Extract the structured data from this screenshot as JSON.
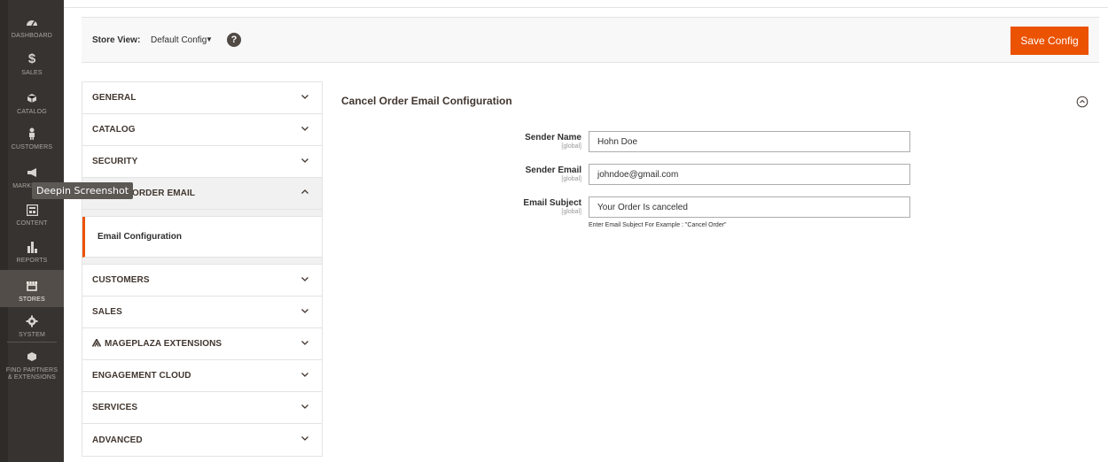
{
  "nav": {
    "items": [
      {
        "label": "DASHBOARD",
        "icon": "dashboard-icon"
      },
      {
        "label": "SALES",
        "icon": "dollar-icon"
      },
      {
        "label": "CATALOG",
        "icon": "cube-icon"
      },
      {
        "label": "CUSTOMERS",
        "icon": "person-icon"
      },
      {
        "label": "MARKETING",
        "icon": "megaphone-icon"
      },
      {
        "label": "CONTENT",
        "icon": "layout-icon"
      },
      {
        "label": "REPORTS",
        "icon": "bar-chart-icon"
      },
      {
        "label": "STORES",
        "icon": "store-icon"
      },
      {
        "label": "SYSTEM",
        "icon": "gear-icon"
      },
      {
        "label": "FIND PARTNERS & EXTENSIONS",
        "icon": "partners-icon"
      }
    ],
    "active": "STORES"
  },
  "tooltip": "Deepin Screenshot",
  "store_view": {
    "label": "Store View:",
    "value": "Default Config",
    "help": "?"
  },
  "save_button": "Save Config",
  "tabs": [
    {
      "label": "GENERAL"
    },
    {
      "label": "CATALOG"
    },
    {
      "label": "SECURITY"
    },
    {
      "label": "CANCEL ORDER EMAIL",
      "open": true
    },
    {
      "label": "CUSTOMERS"
    },
    {
      "label": "SALES"
    },
    {
      "label": "MAGEPLAZA EXTENSIONS"
    },
    {
      "label": "ENGAGEMENT CLOUD"
    },
    {
      "label": "SERVICES"
    },
    {
      "label": "ADVANCED"
    }
  ],
  "subtab": "Email Configuration",
  "section": {
    "title": "Cancel Order Email Configuration",
    "fields": [
      {
        "label": "Sender Name",
        "scope": "[global]",
        "value": "Hohn Doe"
      },
      {
        "label": "Sender Email",
        "scope": "[global]",
        "value": "johndoe@gmail.com"
      },
      {
        "label": "Email Subject",
        "scope": "[global]",
        "value": "Your Order Is canceled"
      }
    ],
    "subject_note": "Enter Email Subject For Example : \"Cancel Order\""
  },
  "colors": {
    "accent": "#eb5202",
    "nav_bg": "#373330"
  }
}
